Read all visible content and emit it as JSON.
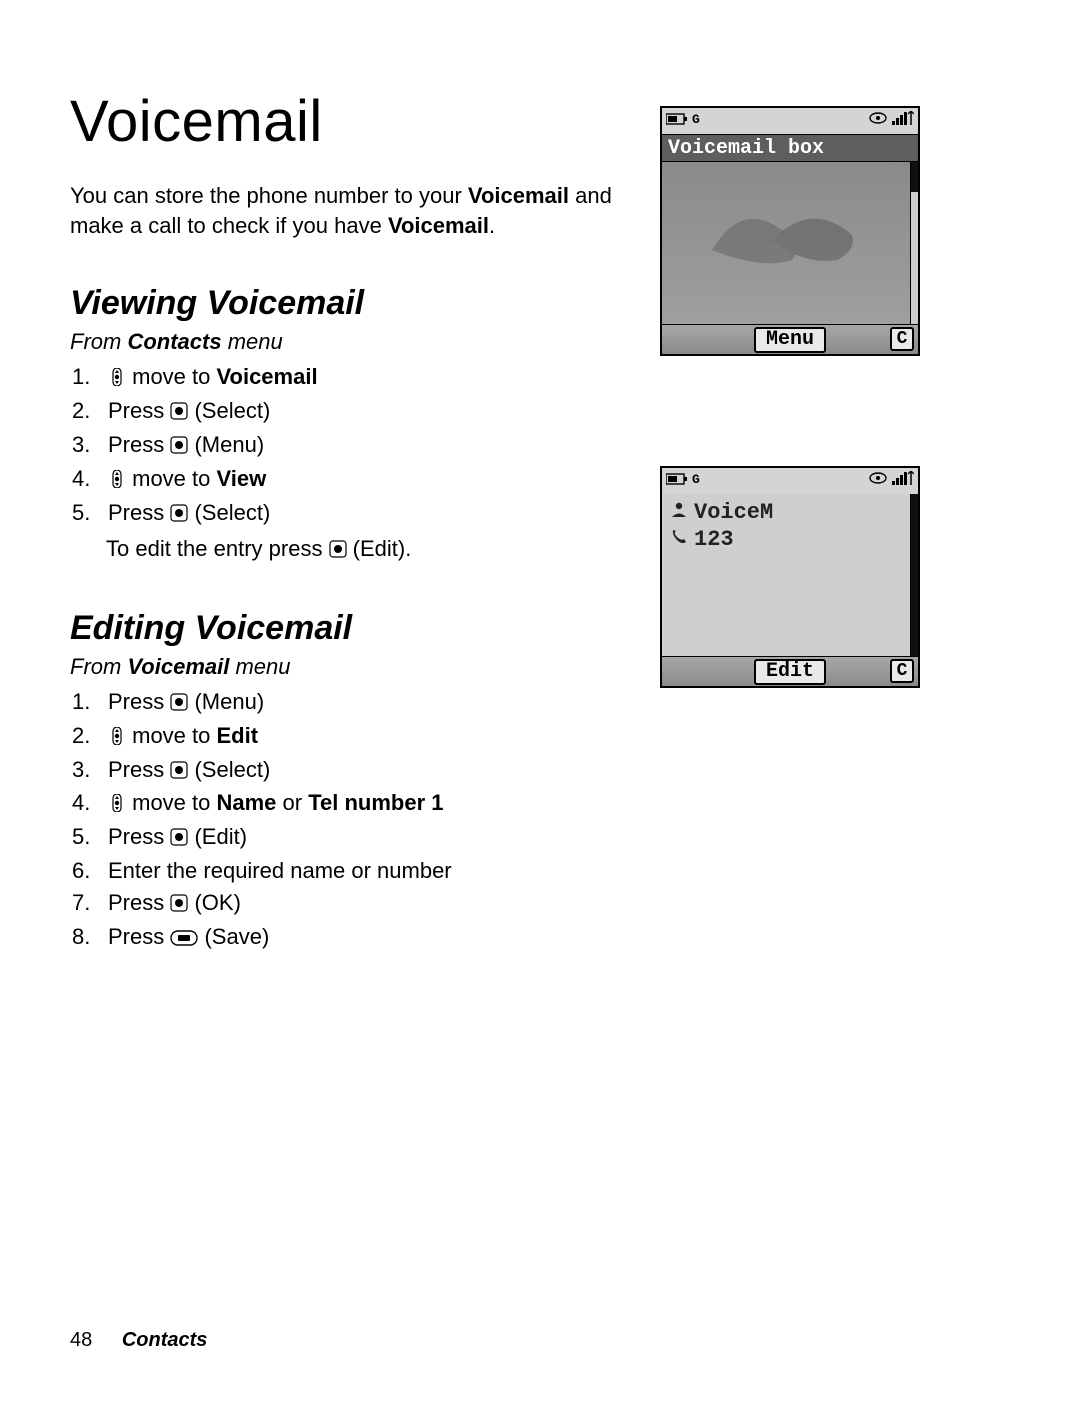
{
  "page": {
    "title": "Voicemail",
    "intro_pre": "You can store the phone number to your ",
    "intro_b1": "Voicemail",
    "intro_mid": " and make a call to check if you have ",
    "intro_b2": "Voicemail",
    "intro_post": "."
  },
  "section1": {
    "heading": "Viewing Voicemail",
    "from_pre": "From ",
    "from_b": "Contacts",
    "from_post": " menu",
    "steps": {
      "s1_pre": " move to ",
      "s1_b": "Voicemail",
      "s2": "Press ",
      "s2_paren": " (Select)",
      "s3": "Press ",
      "s3_paren": " (Menu)",
      "s4_pre": " move to ",
      "s4_b": "View",
      "s5": "Press ",
      "s5_paren": " (Select)",
      "s5_sub_pre": "To edit the entry press ",
      "s5_sub_paren": " (Edit)."
    }
  },
  "section2": {
    "heading": "Editing Voicemail",
    "from_pre": "From ",
    "from_b": "Voicemail",
    "from_post": " menu",
    "steps": {
      "s1": "Press ",
      "s1_paren": " (Menu)",
      "s2_pre": " move to ",
      "s2_b": "Edit",
      "s3": "Press ",
      "s3_paren": " (Select)",
      "s4_pre": " move to ",
      "s4_b1": "Name",
      "s4_or": " or ",
      "s4_b2": "Tel number 1",
      "s5": "Press ",
      "s5_paren": " (Edit)",
      "s6": "Enter the required name or number",
      "s7": "Press ",
      "s7_paren": " (OK)",
      "s8": "Press ",
      "s8_paren": " (Save)"
    }
  },
  "phone1": {
    "title": "Voicemail box",
    "menu": "Menu",
    "c": "C"
  },
  "phone2": {
    "line1": "VoiceM",
    "line2": "123",
    "edit": "Edit",
    "c": "C"
  },
  "footer": {
    "page": "48",
    "section": "Contacts"
  }
}
